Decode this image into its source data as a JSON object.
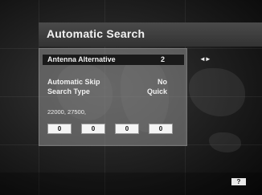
{
  "title": "Automatic Search",
  "menu": {
    "antenna_alternative": {
      "label": "Antenna Alternative",
      "value": "2"
    },
    "automatic_skip": {
      "label": "Automatic Skip",
      "value": "No"
    },
    "search_type": {
      "label": "Search Type",
      "value": "Quick"
    }
  },
  "symbol_rates": "22000, 27500,",
  "slots": [
    "0",
    "0",
    "0",
    "0"
  ],
  "help_label": "?",
  "navigation_hint": "◄►"
}
